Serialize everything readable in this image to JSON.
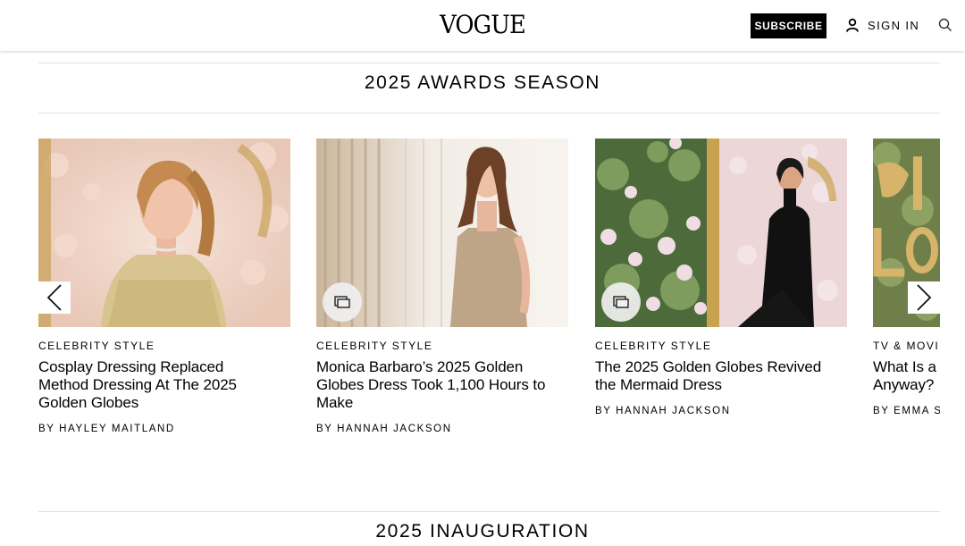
{
  "header": {
    "logo": "VOGUE",
    "subscribe_label": "SUBSCRIBE",
    "signin_label": "SIGN IN"
  },
  "sections": [
    {
      "title": "2025 AWARDS SEASON"
    },
    {
      "title": "2025 INAUGURATION"
    }
  ],
  "cards": [
    {
      "kicker": "CELEBRITY STYLE",
      "headline_lines": [
        "Cosplay Dressing Replaced",
        "Method Dressing At The 2025",
        "Golden Globes"
      ],
      "byline": "BY HAYLEY MAITLAND",
      "gallery": false
    },
    {
      "kicker": "CELEBRITY STYLE",
      "headline_lines": [
        "Monica Barbaro’s 2025 Golden",
        "Globes Dress Took 1,100 Hours to",
        "Make"
      ],
      "byline": "BY HANNAH JACKSON",
      "gallery": true
    },
    {
      "kicker": "CELEBRITY STYLE",
      "headline_lines": [
        "The 2025 Golden Globes Revived",
        "the Mermaid Dress"
      ],
      "byline": "BY HANNAH JACKSON",
      "gallery": true
    },
    {
      "kicker": "TV & MOVIES",
      "headline_lines": [
        "What Is a",
        "Anyway?"
      ],
      "byline": "BY EMMA S",
      "gallery": false
    }
  ],
  "icons": {
    "signin": "person-icon",
    "search": "search-icon",
    "gallery": "gallery-icon",
    "prev": "chevron-left-icon",
    "next": "chevron-right-icon"
  }
}
